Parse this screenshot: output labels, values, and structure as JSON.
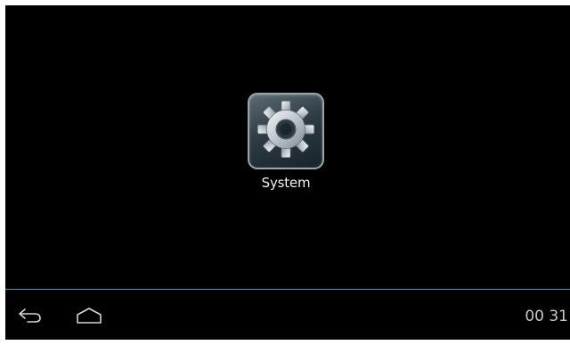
{
  "launcher": {
    "apps": [
      {
        "label": "System",
        "icon": "gear-icon"
      }
    ]
  },
  "nav_bar": {
    "back_icon": "back-arrow-icon",
    "home_icon": "home-icon",
    "clock": "00 31"
  },
  "colors": {
    "screen_background": "#000000",
    "divider": "#6f8ca0",
    "label_text": "#f2f2f2",
    "clock_text": "#c8c8c8"
  }
}
